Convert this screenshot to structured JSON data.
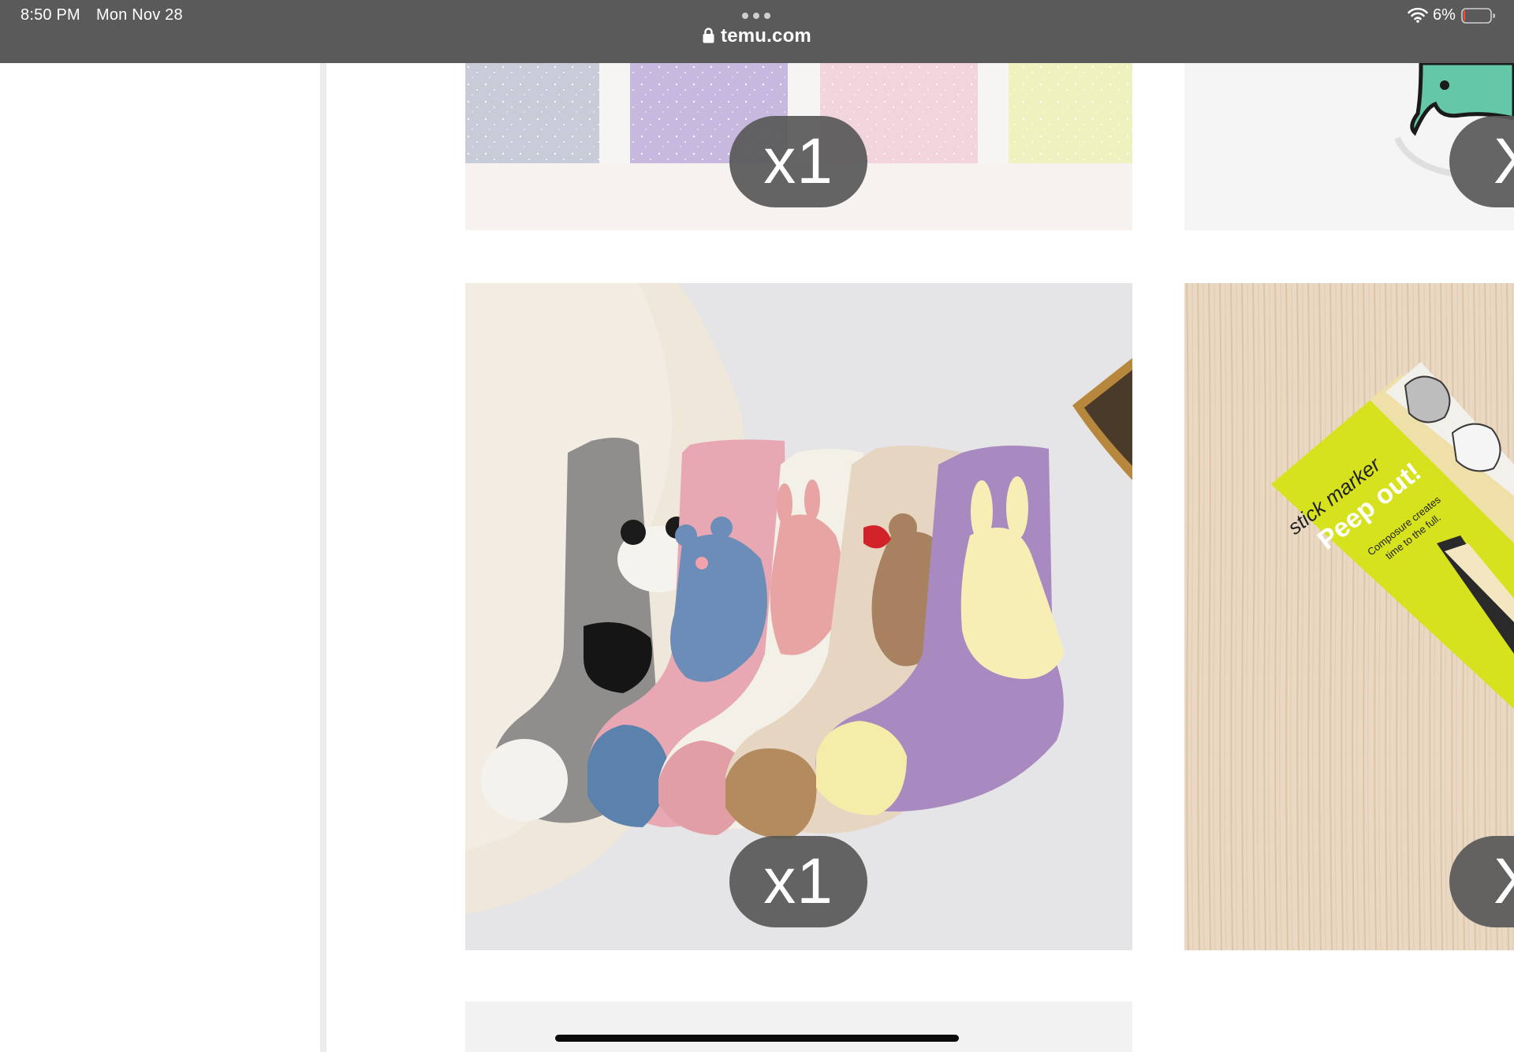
{
  "status_bar": {
    "time": "8:50 PM",
    "date": "Mon Nov 28",
    "url": "temu.com",
    "battery_percent": "6%",
    "battery_level": 0.06,
    "wifi_icon": "wifi-icon",
    "lock_icon": "lock-icon",
    "tab_icon": "more-dots-icon"
  },
  "products": {
    "top_left": {
      "quantity": "x1",
      "image": "sparkle color swatches"
    },
    "top_right": {
      "quantity": "X",
      "image": "cartoon character"
    },
    "middle_left": {
      "quantity": "x1",
      "image": "fuzzy animal socks five pack"
    },
    "middle_right": {
      "quantity": "X",
      "image": "stick marker sticky notes",
      "package_text": {
        "brand": "stick marker",
        "headline": "Peep out!",
        "tagline_1": "Composure creates",
        "tagline_2": "time to the full."
      }
    }
  },
  "colors": {
    "status_bar_bg": "#5a5a5a",
    "badge_bg": "#585858",
    "page_bg": "#ffffff"
  }
}
